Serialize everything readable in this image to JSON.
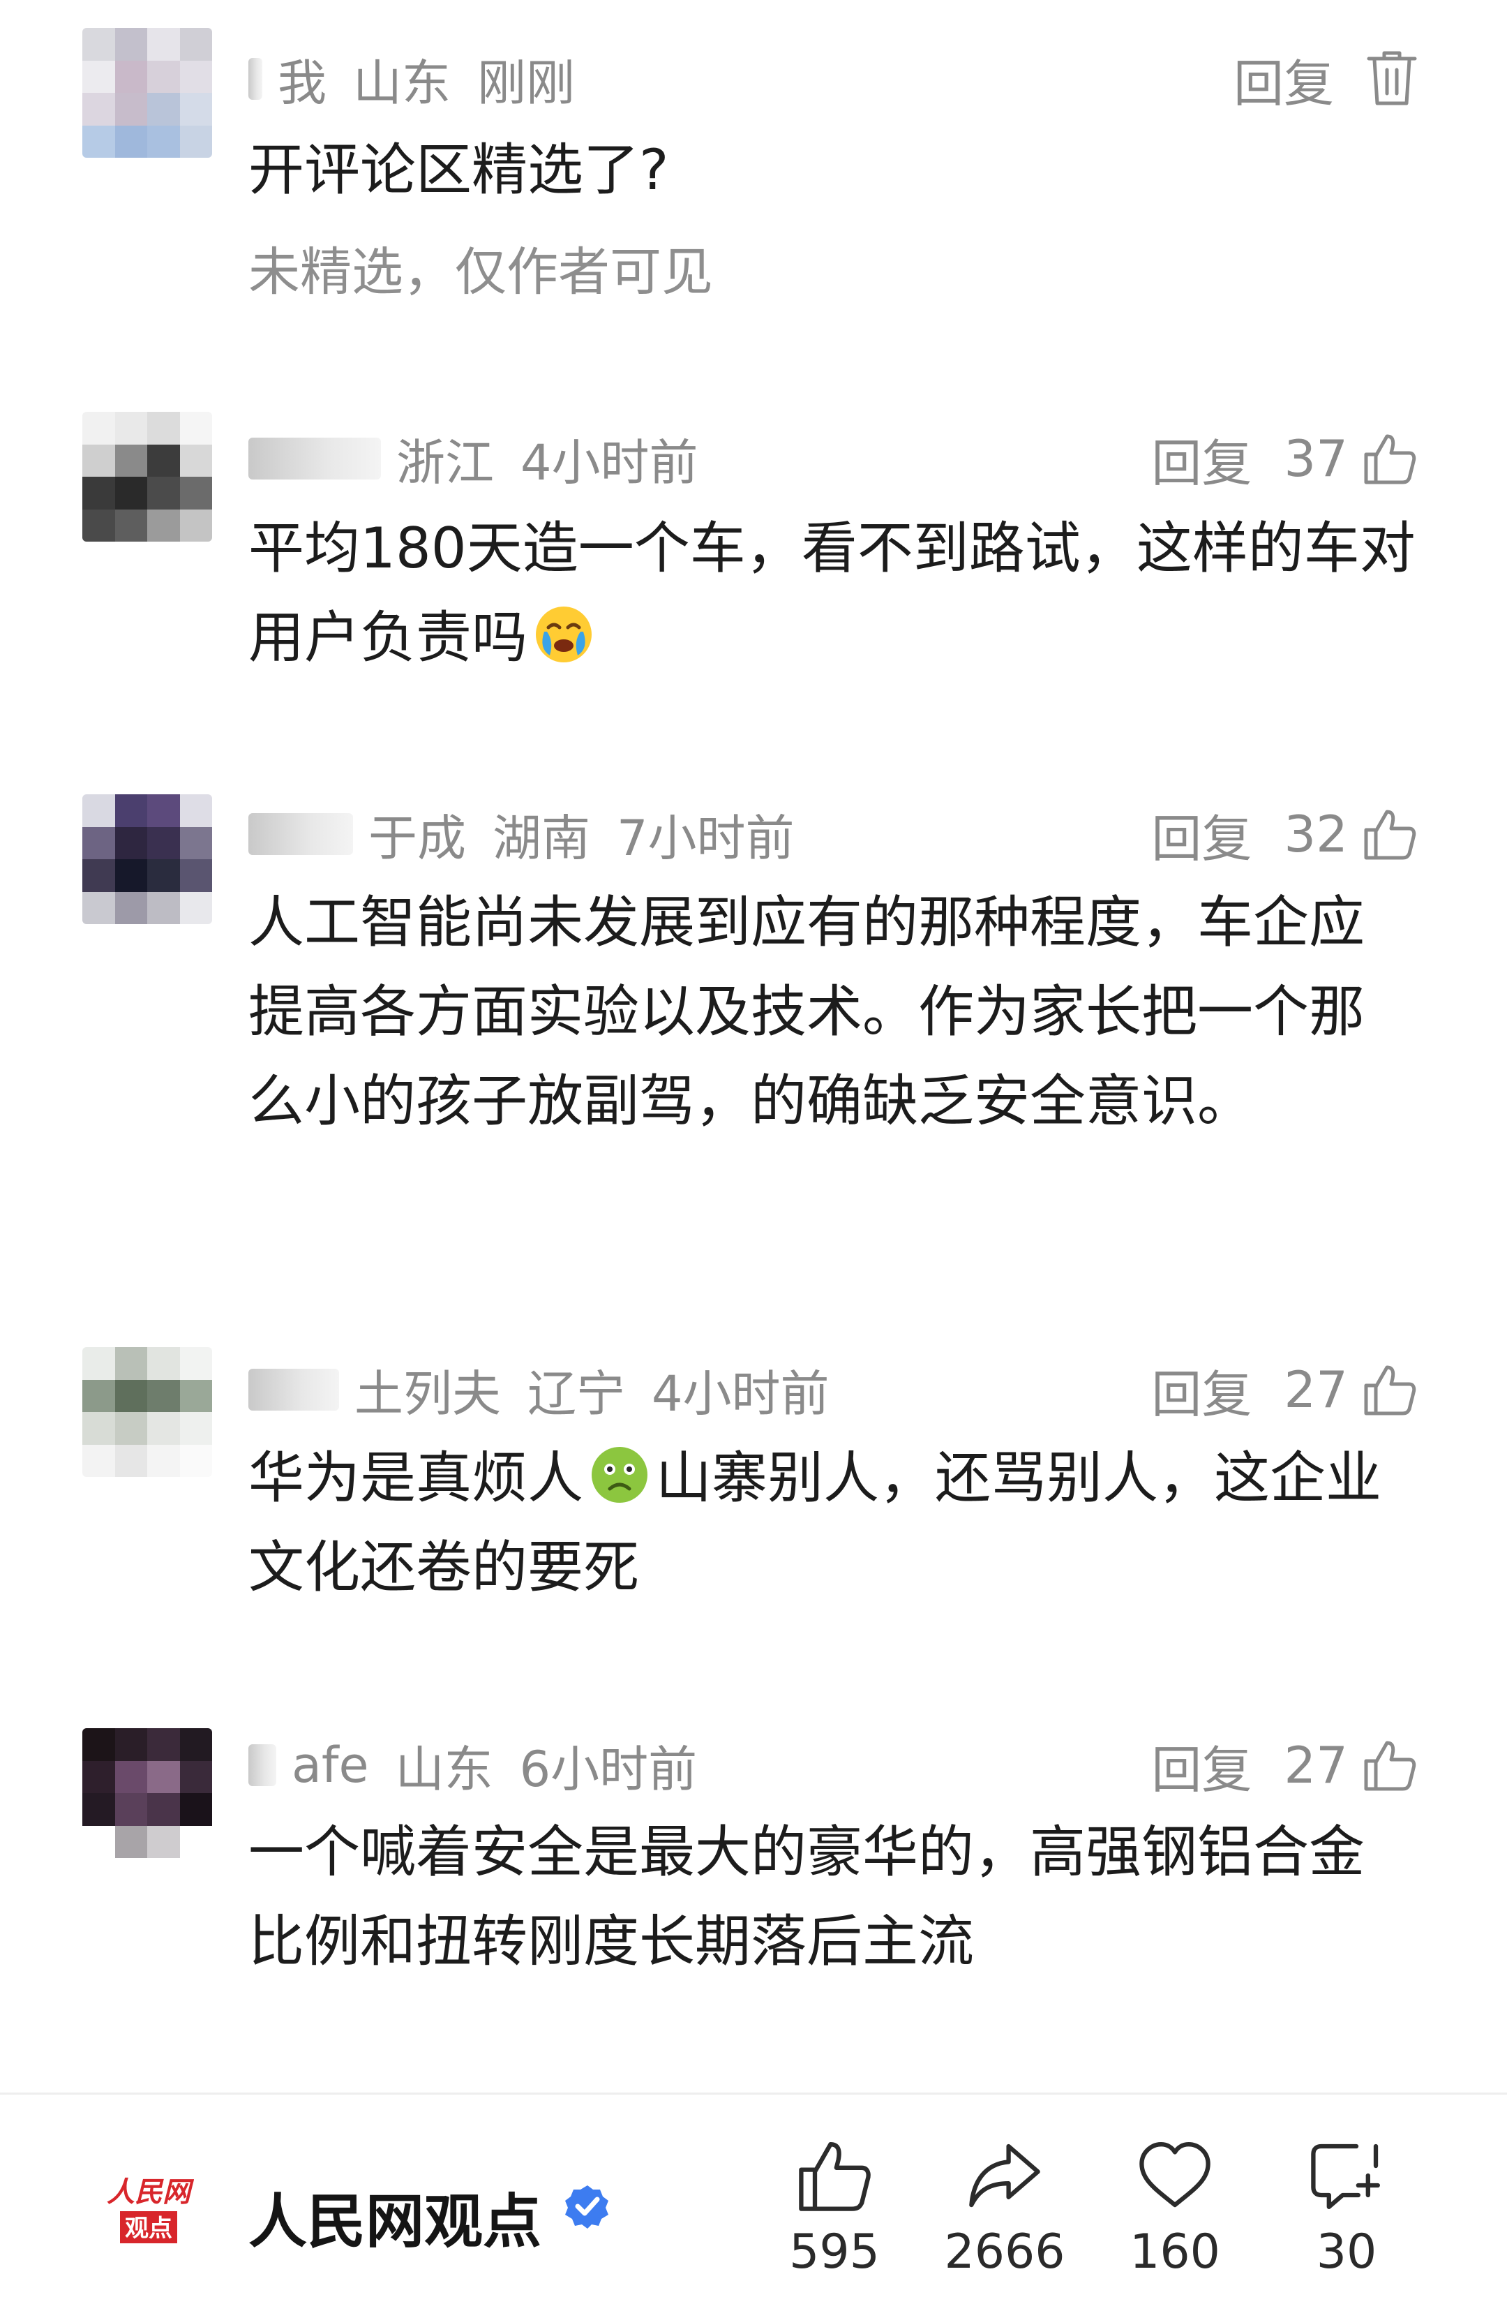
{
  "comments": [
    {
      "meta": [
        "我",
        "山东",
        "刚刚"
      ],
      "reply": "回复",
      "text": "开评论区精选了?",
      "note": "未精选，仅作者可见"
    },
    {
      "meta": [
        "浙江",
        "4小时前"
      ],
      "reply": "回复",
      "likes": "37",
      "text_a": "平均180天造一个车，看不到路试，这样的车对用户负责吗",
      "emoji": "crying-face-emoji"
    },
    {
      "meta": [
        "于成",
        "湖南",
        "7小时前"
      ],
      "reply": "回复",
      "likes": "32",
      "text": "人工智能尚未发展到应有的那种程度，车企应提高各方面实验以及技术。作为家长把一个那么小的孩子放副驾，的确缺乏安全意识。"
    },
    {
      "meta": [
        "土列夫",
        "辽宁",
        "4小时前"
      ],
      "reply": "回复",
      "likes": "27",
      "text_a": "华为是真烦人",
      "emoji": "nauseated-face-emoji",
      "text_b": "山寨别人，还骂别人，这企业文化还卷的要死"
    },
    {
      "meta": [
        "afe",
        "山东",
        "6小时前"
      ],
      "reply": "回复",
      "likes": "27",
      "text": "一个喊着安全是最大的豪华的，高强钢铝合金比例和扭转刚度长期落后主流"
    }
  ],
  "bottom_bar": {
    "logo_line1": "人民网",
    "logo_line2": "观点",
    "account_name": "人民网观点",
    "stats": {
      "likes": "595",
      "shares": "2666",
      "favorites": "160",
      "comments": "30"
    }
  },
  "colors": {
    "meta_gray": "#8a8a8a",
    "verified_blue": "#3d7cf0",
    "logo_red": "#d8262b"
  }
}
